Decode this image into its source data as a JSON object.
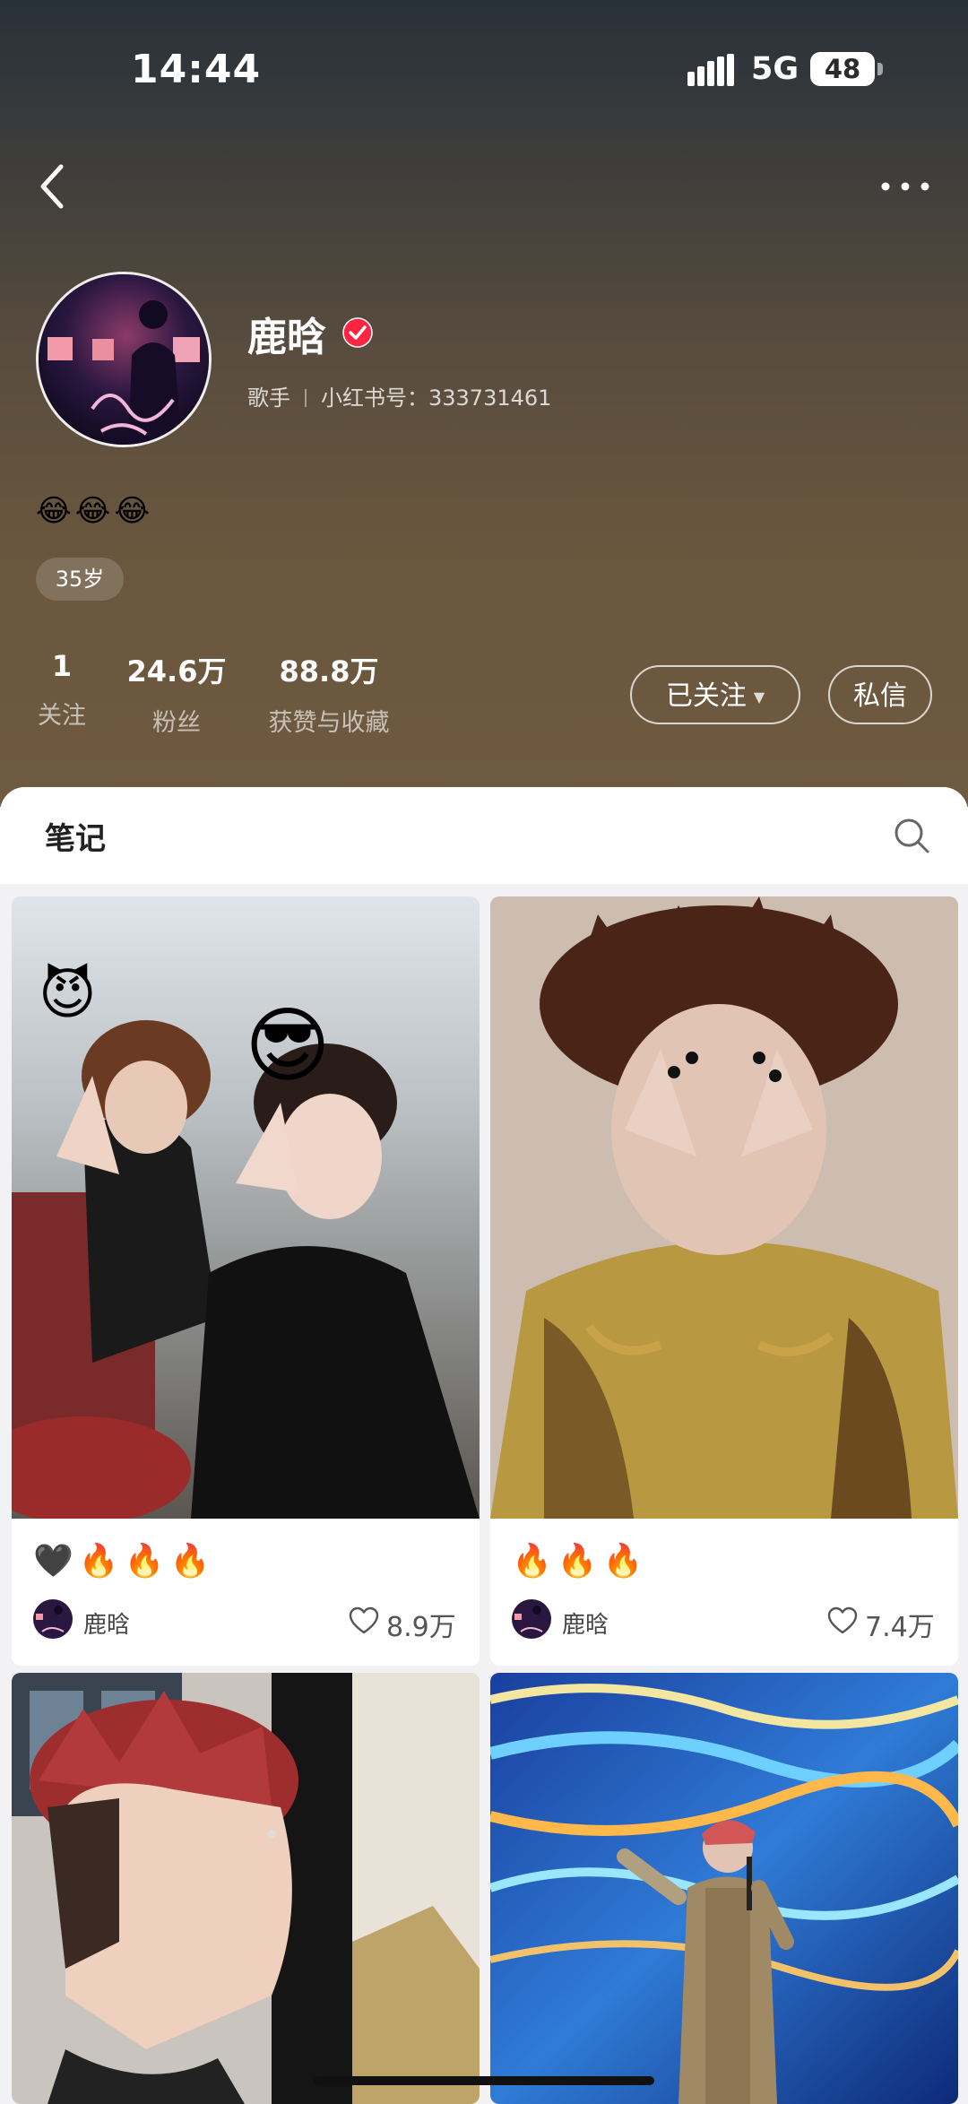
{
  "status_bar": {
    "time": "14:44",
    "network": "5G",
    "battery": "48"
  },
  "profile": {
    "name": "鹿晗",
    "role": "歌手",
    "id_label": "小红书号：333731461",
    "bio": "😂😂😂",
    "age_tag": "35岁",
    "stats": [
      {
        "value": "1",
        "label": "关注"
      },
      {
        "value": "24.6万",
        "label": "粉丝"
      },
      {
        "value": "88.8万",
        "label": "获赞与收藏"
      }
    ],
    "follow_button": "已关注",
    "message_button": "私信"
  },
  "notes_section": {
    "tab": "笔记"
  },
  "notes": [
    {
      "emojis": "🖤🔥🔥🔥",
      "author": "鹿晗",
      "likes": "8.9万"
    },
    {
      "emojis": "🔥🔥🔥",
      "author": "鹿晗",
      "likes": "7.4万"
    },
    {
      "emojis": "",
      "author": "",
      "likes": ""
    },
    {
      "emojis": "",
      "author": "",
      "likes": ""
    }
  ],
  "colors": {
    "verified": "#ff2442",
    "header_top": "#28313a",
    "header_bottom": "#6f5a40"
  }
}
